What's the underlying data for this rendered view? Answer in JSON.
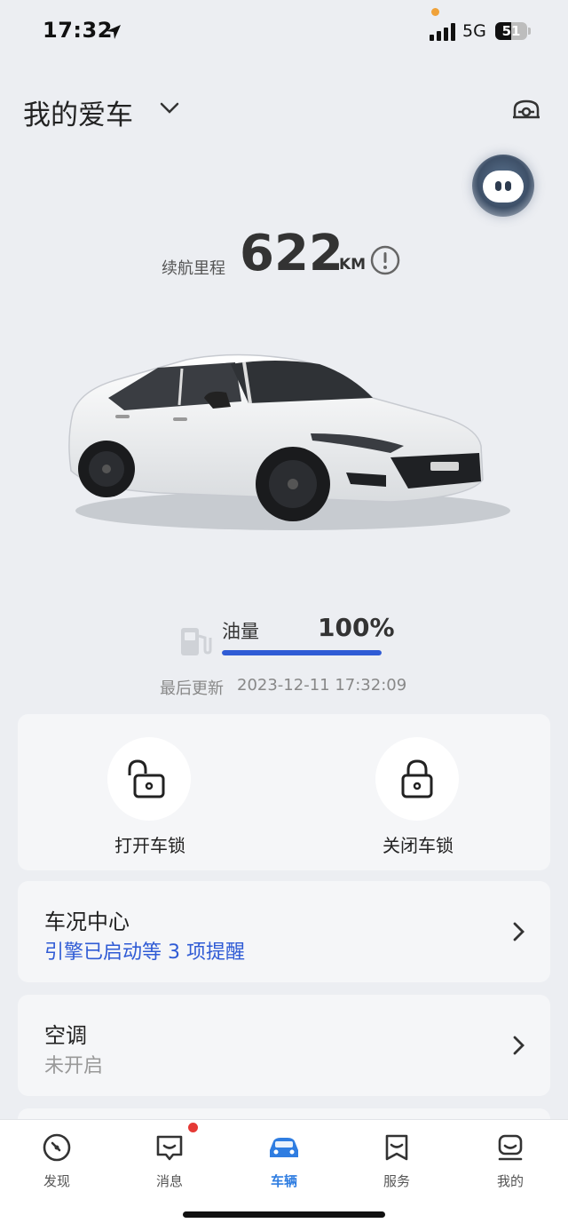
{
  "status_bar": {
    "time": "17:32",
    "network": "5G",
    "battery_level": "51",
    "battery_percent": 0.51
  },
  "header": {
    "title": "我的爱车"
  },
  "range": {
    "label": "续航里程",
    "value": "622",
    "unit": "KM"
  },
  "fuel": {
    "label": "油量",
    "value": "100%",
    "level_percent": 100,
    "updated_label": "最后更新",
    "updated_value": "2023-12-11 17:32:09"
  },
  "lock": {
    "unlock_label": "打开车锁",
    "lock_label": "关闭车锁"
  },
  "status_center": {
    "title": "车况中心",
    "subtitle": "引擎已启动等 3 项提醒",
    "subtitle_color": "#2f5bd5"
  },
  "climate": {
    "title": "空调",
    "subtitle": "未开启",
    "subtitle_color": "#999999"
  },
  "tabs": [
    {
      "label": "发现",
      "icon": "compass-icon"
    },
    {
      "label": "消息",
      "icon": "message-icon"
    },
    {
      "label": "车辆",
      "icon": "car-icon"
    },
    {
      "label": "服务",
      "icon": "service-icon"
    },
    {
      "label": "我的",
      "icon": "profile-icon"
    }
  ],
  "colors": {
    "accent": "#2f7de1",
    "fuel_bar": "#2f5bd5",
    "notification_dot": "#e53935"
  }
}
